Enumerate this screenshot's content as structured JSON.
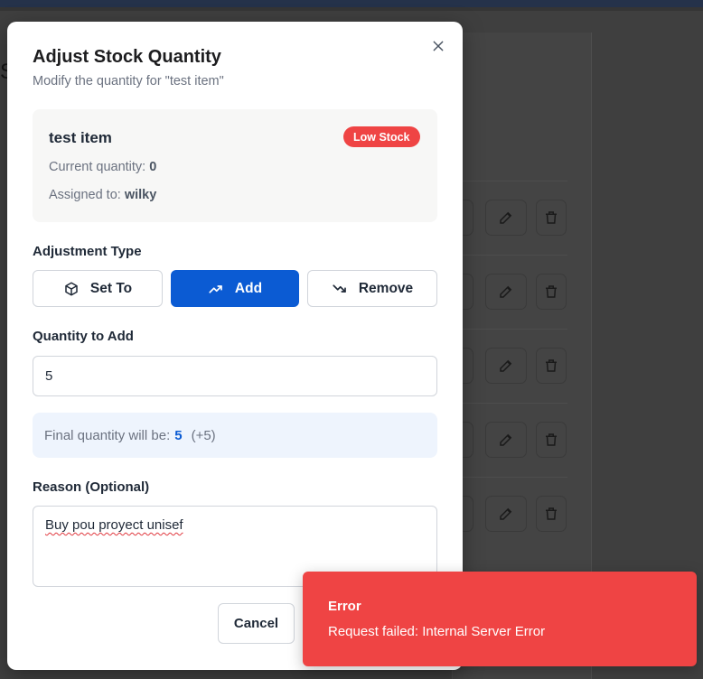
{
  "dialog": {
    "title": "Adjust Stock Quantity",
    "subtitle": "Modify the quantity for \"test item\"",
    "close_icon": "close-icon"
  },
  "item": {
    "name": "test item",
    "status_badge": "Low Stock",
    "current_quantity_label": "Current quantity:",
    "current_quantity": "0",
    "assigned_label": "Assigned to:",
    "assigned_to": "wilky"
  },
  "adjustment": {
    "label": "Adjustment Type",
    "selected": "Add",
    "options": [
      {
        "label": "Set To",
        "icon": "box-icon"
      },
      {
        "label": "Add",
        "icon": "trending-up-icon"
      },
      {
        "label": "Remove",
        "icon": "trending-down-icon"
      }
    ]
  },
  "quantity": {
    "label": "Quantity to Add",
    "value": "5"
  },
  "summary": {
    "prefix": "Final quantity will be:",
    "final_value": "5",
    "delta": "(+5)"
  },
  "reason": {
    "label": "Reason (Optional)",
    "value": "Buy pou proyect unisef"
  },
  "actions": {
    "cancel": "Cancel"
  },
  "toast": {
    "title": "Error",
    "message": "Request failed: Internal Server Error"
  },
  "colors": {
    "primary": "#0b5bd3",
    "danger": "#ef4444",
    "overlay": "#3f3f3f"
  }
}
